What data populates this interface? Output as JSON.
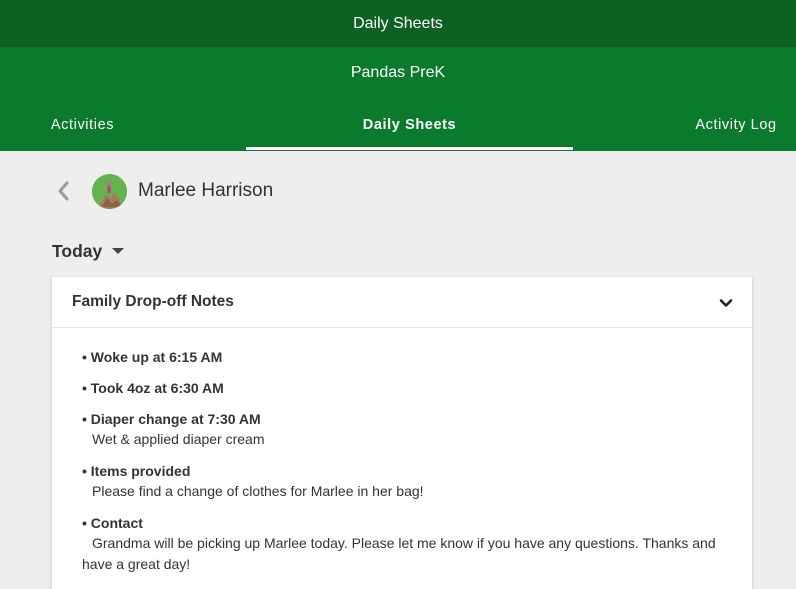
{
  "app": {
    "title": "Daily Sheets"
  },
  "classroom": {
    "name": "Pandas PreK"
  },
  "tabs": [
    {
      "label": "Activities",
      "active": false
    },
    {
      "label": "Daily Sheets",
      "active": true
    },
    {
      "label": "Activity Log",
      "active": false
    }
  ],
  "child": {
    "name": "Marlee Harrison"
  },
  "date_filter": {
    "label": "Today"
  },
  "card": {
    "title": "Family Drop-off Notes",
    "notes": [
      {
        "heading": "Woke up at 6:15 AM",
        "body": ""
      },
      {
        "heading": "Took 4oz at 6:30 AM",
        "body": ""
      },
      {
        "heading": "Diaper change at 7:30 AM",
        "body": "Wet & applied diaper cream"
      },
      {
        "heading": "Items provided",
        "body": "Please find a change of clothes for Marlee in her bag!"
      },
      {
        "heading": "Contact",
        "body": "Grandma will be picking up Marlee today. Please let me know if you have any questions. Thanks and have a great day!"
      }
    ]
  },
  "colors": {
    "header_dark": "#0e6221",
    "header": "#0a7a2c",
    "background": "#eeeeee"
  },
  "icons": {
    "back": "chevron-left-icon",
    "expand": "chevron-down-icon",
    "dropdown": "caret-down-icon"
  }
}
